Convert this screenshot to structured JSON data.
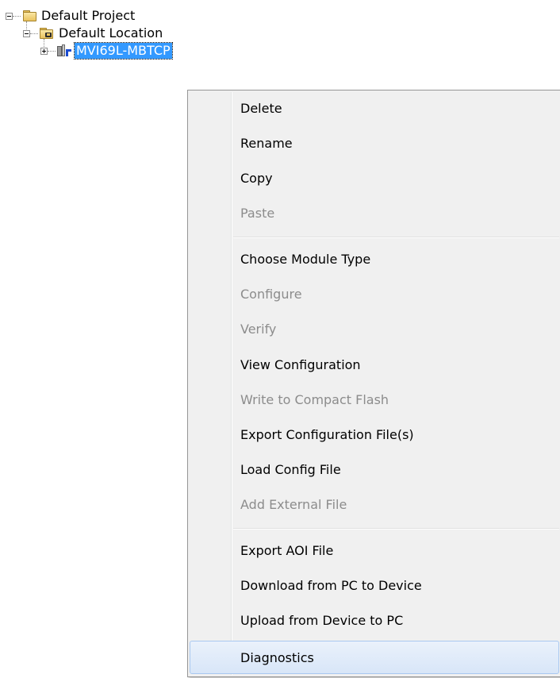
{
  "tree": {
    "root": {
      "label": "Default Project",
      "icon": "folder-icon",
      "expanded": true
    },
    "location": {
      "label": "Default Location",
      "icon": "location-folder-icon",
      "expanded": true
    },
    "module": {
      "label": "MVI69L-MBTCP",
      "icon": "module-icon",
      "expanded": false,
      "selected": true
    }
  },
  "context_menu": {
    "groups": [
      [
        {
          "label": "Delete",
          "enabled": true
        },
        {
          "label": "Rename",
          "enabled": true
        },
        {
          "label": "Copy",
          "enabled": true
        },
        {
          "label": "Paste",
          "enabled": false
        }
      ],
      [
        {
          "label": "Choose Module Type",
          "enabled": true
        },
        {
          "label": "Configure",
          "enabled": false
        },
        {
          "label": "Verify",
          "enabled": false
        },
        {
          "label": "View Configuration",
          "enabled": true
        },
        {
          "label": "Write to Compact Flash",
          "enabled": false
        },
        {
          "label": "Export Configuration File(s)",
          "enabled": true
        },
        {
          "label": "Load Config File",
          "enabled": true
        },
        {
          "label": "Add External File",
          "enabled": false
        }
      ],
      [
        {
          "label": "Export AOI File",
          "enabled": true
        },
        {
          "label": "Download from PC to Device",
          "enabled": true
        },
        {
          "label": "Upload from Device to PC",
          "enabled": true
        },
        {
          "label": "Diagnostics",
          "enabled": true,
          "highlighted": true
        }
      ]
    ]
  },
  "colors": {
    "selection": "#3399ff",
    "menu_background": "#f0f0f0",
    "disabled_text": "#8c8c8c",
    "hover_highlight": "#d8e6f8"
  }
}
